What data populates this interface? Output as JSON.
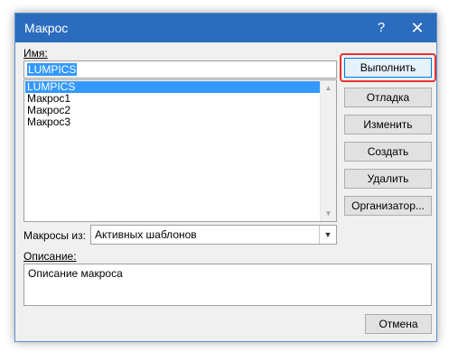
{
  "window": {
    "title": "Макрос",
    "help_label": "?",
    "close_label": "✕"
  },
  "name_label": "Имя:",
  "name_value": "LUMPICS",
  "macros": {
    "items": [
      "LUMPICS",
      "Макрос1",
      "Макрос2",
      "Макрос3"
    ],
    "selected_index": 0
  },
  "buttons": {
    "run": "Выполнить",
    "debug": "Отладка",
    "edit": "Изменить",
    "create": "Создать",
    "delete": "Удалить",
    "organizer": "Организатор...",
    "cancel": "Отмена"
  },
  "macros_from": {
    "label": "Макросы из:",
    "value": "Активных шаблонов"
  },
  "description": {
    "label": "Описание:",
    "value": "Описание макроса"
  },
  "colors": {
    "titlebar": "#2b6cbf",
    "selection": "#3399ff",
    "highlight": "#e53333"
  }
}
